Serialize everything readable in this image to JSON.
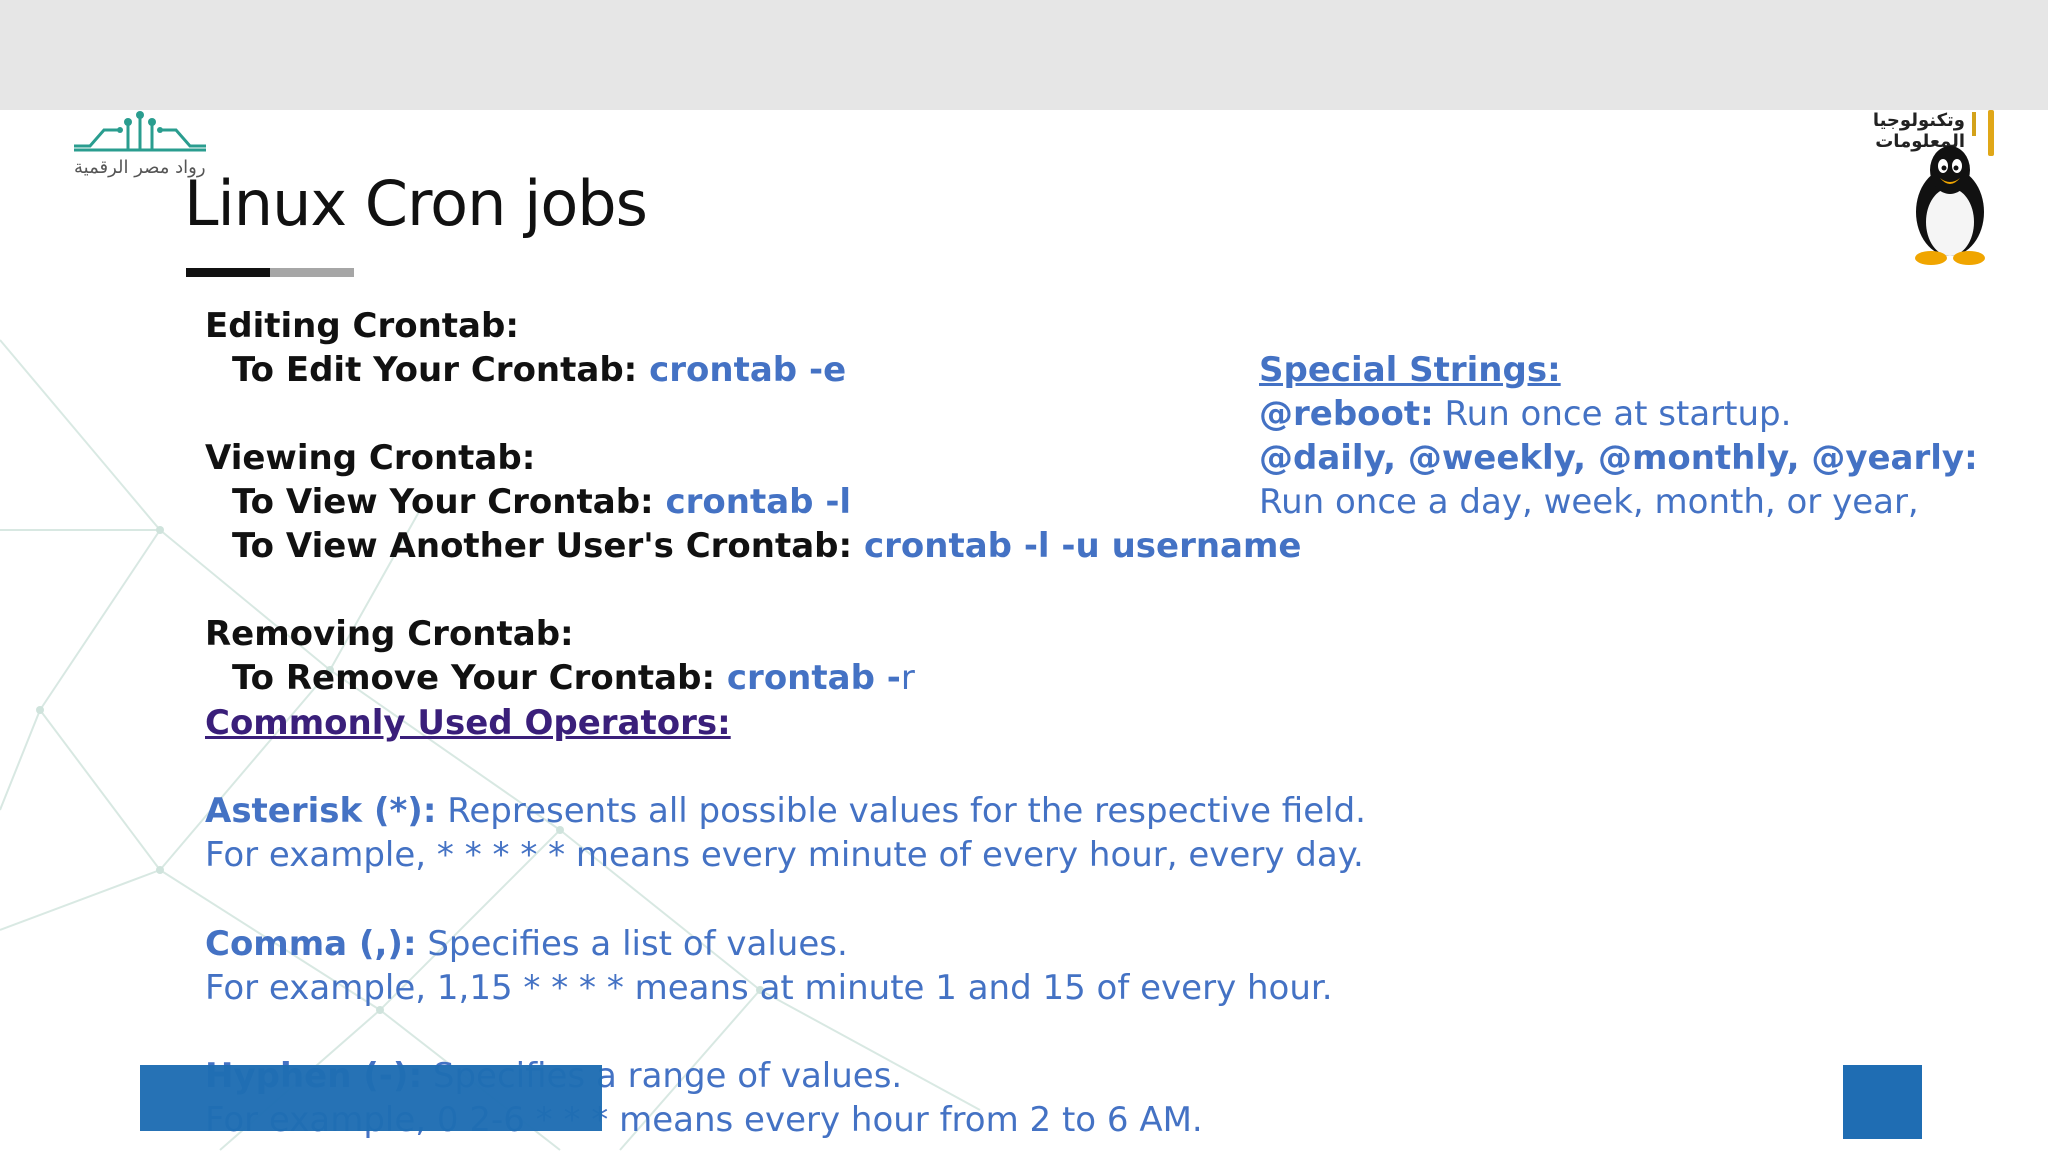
{
  "branding": {
    "left_logo_text": "رواد مصر الرقمية",
    "right_logo_text": "وتكنولوجيا المعلومات",
    "right_icon": "tux-penguin-icon",
    "left_icon": "circuit-logo-icon",
    "accent_color": "#4472c4",
    "bottom_bar_color": "#1f6db3"
  },
  "slide": {
    "title": "Linux Cron jobs",
    "editing": {
      "heading": "Editing Crontab:",
      "edit_label": "To Edit Your Crontab: ",
      "edit_cmd": "crontab -e"
    },
    "viewing": {
      "heading": "Viewing Crontab:",
      "view_label": "To View Your Crontab: ",
      "view_cmd": "crontab -l",
      "view_other_label": "To View Another User's Crontab: ",
      "view_other_cmd": "crontab -l -u username"
    },
    "removing": {
      "heading": "Removing Crontab:",
      "remove_label": "To Remove Your Crontab: ",
      "remove_cmd": "crontab -",
      "remove_cmd_tail": "r"
    },
    "operators": {
      "heading": "Commonly Used Operators:",
      "asterisk_term": "Asterisk (*):",
      "asterisk_desc": " Represents all possible values for the respective field.",
      "asterisk_example": "For example, * * * * * means every minute of every hour, every day.",
      "comma_term": "Comma (,):",
      "comma_desc": " Specifies a list of values.",
      "comma_example": "For example, 1,15 * * * * means at minute 1 and 15 of every hour.",
      "hyphen_term": "Hyphen (-):",
      "hyphen_desc": " Specifies a range of values.",
      "hyphen_example": "For example, 0 2-6 * * * means every hour from 2 to 6 AM."
    },
    "special": {
      "heading": "Special Strings:",
      "reboot_term": "@reboot:",
      "reboot_desc": " Run once at startup.",
      "periodic_terms": "@daily, @weekly, @monthly, @yearly:",
      "periodic_desc": "Run once a day, week, month, or year,"
    }
  }
}
